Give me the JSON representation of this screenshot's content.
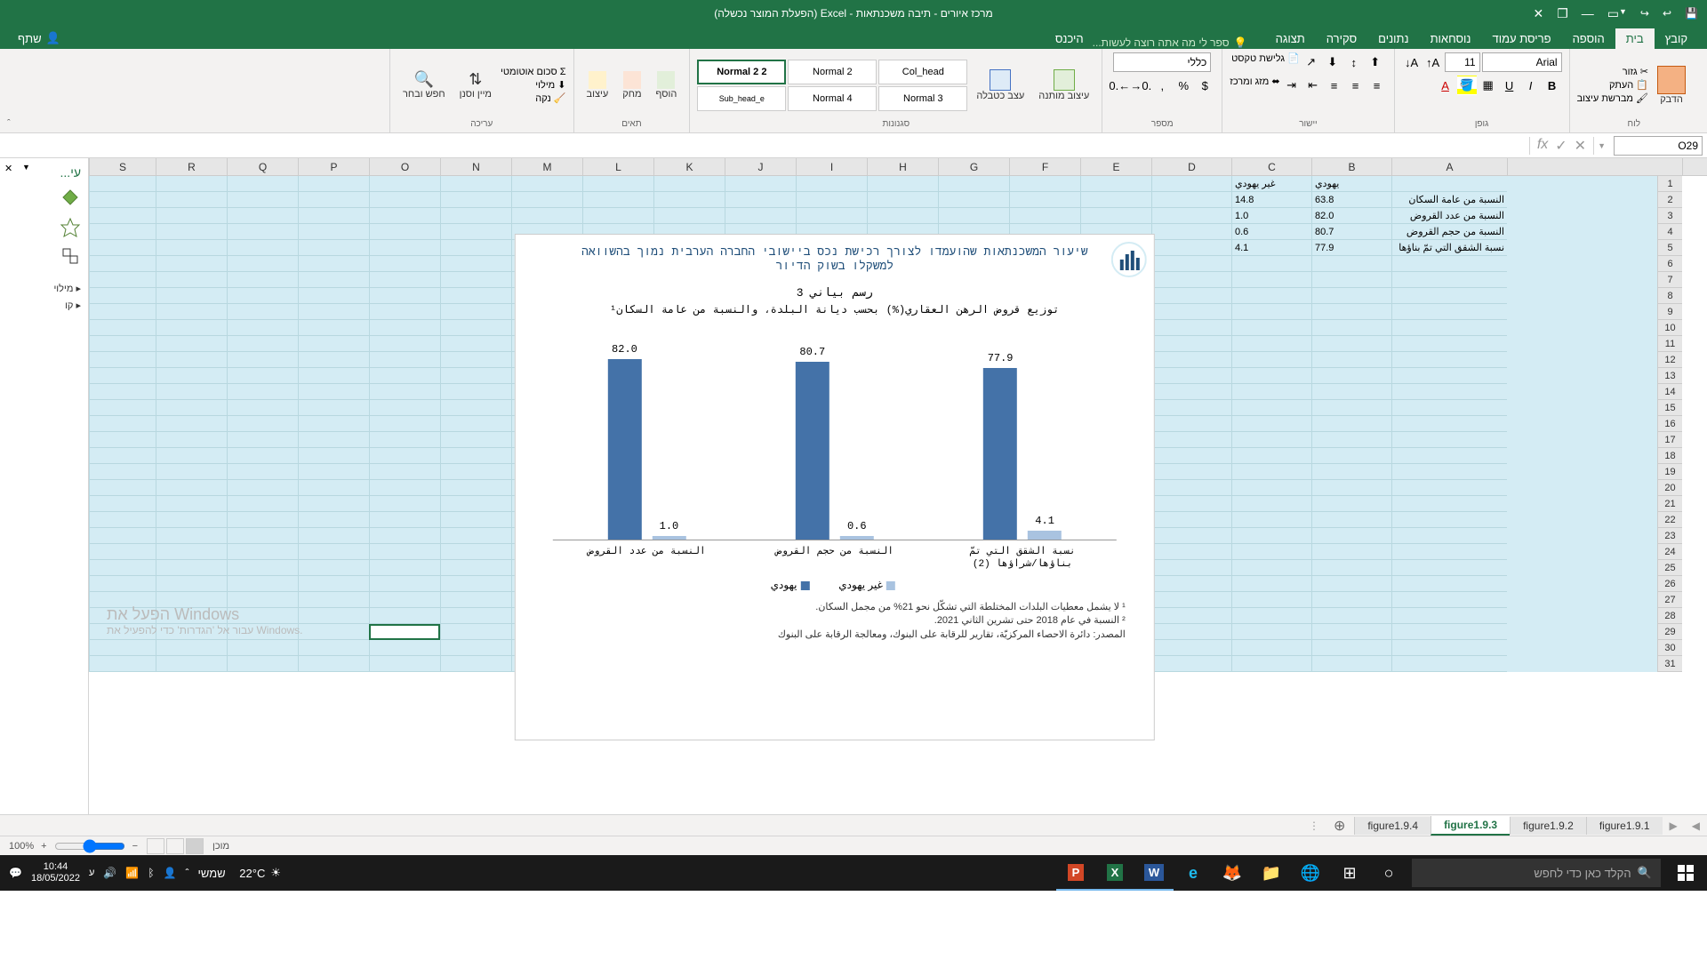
{
  "titlebar": {
    "title": "מרכז איורים - תיבה משכנתאות - Excel (הפעלת המוצר נכשלה)"
  },
  "menu": {
    "file": "קובץ",
    "home": "בית",
    "insert": "הוספה",
    "pagelayout": "פריסת עמוד",
    "formulas": "נוסחאות",
    "data": "נתונים",
    "review": "סקירה",
    "view": "תצוגה",
    "tellme": "ספר לי מה אתה רוצה לעשות...",
    "signin": "היכנס",
    "share": "שתף"
  },
  "ribbon": {
    "clipboard": {
      "label": "לוח",
      "paste": "הדבק",
      "cut": "גזור",
      "copy": "העתק",
      "formatpainter": "מברשת עיצוב"
    },
    "font": {
      "label": "גופן",
      "name": "Arial",
      "size": "11"
    },
    "alignment": {
      "label": "יישור",
      "wrap": "גלישת טקסט",
      "merge": "מזג ומרכז"
    },
    "number": {
      "label": "מספר",
      "format": "כללי"
    },
    "styles": {
      "label": "סגנונות",
      "conditional": "עיצוב מותנה",
      "table": "עצב כטבלה",
      "s1": "Normal 2",
      "s2": "Normal 2 2",
      "s3": "Col_head",
      "s4": "Normal 3",
      "s5": "Normal 4",
      "s6": "Sub_head_e"
    },
    "cells": {
      "label": "תאים",
      "insert": "הוסף",
      "delete": "מחק",
      "format": "עיצוב"
    },
    "editing": {
      "label": "עריכה",
      "sum": "סכום אוטומטי",
      "fill": "מילוי",
      "clear": "נקה",
      "sort": "מיין וסנן",
      "find": "חפש ובחר"
    }
  },
  "namebox": "O29",
  "sidepanel": {
    "title": "עי...",
    "fill": "מילוי",
    "line": "קו"
  },
  "columns": [
    "A",
    "B",
    "C",
    "D",
    "E",
    "F",
    "G",
    "H",
    "I",
    "J",
    "K",
    "L",
    "M",
    "N",
    "O",
    "P",
    "Q",
    "R",
    "S"
  ],
  "data_rows": {
    "h_jewish": "يهودي",
    "h_nonjewish": "غير يهودي",
    "r2_label": "النسبة من عامة السكان",
    "r2_b": "63.8",
    "r2_c": "14.8",
    "r3_label": "النسبة من عدد القروض",
    "r3_b": "82.0",
    "r3_c": "1.0",
    "r4_label": "النسبة من حجم القروض",
    "r4_b": "80.7",
    "r4_c": "0.6",
    "r5_label": "نسبة الشقق التي تمّ بناؤها",
    "r5_b": "77.9",
    "r5_c": "4.1"
  },
  "chart_data": {
    "type": "bar",
    "title_he": "שיעור המשכנתאות שהועמדו לצורך רכישת נכס ביישובי החברה הערבית נמוך בהשוואה למשקלו בשוק הדיור",
    "title_ar_num": "رسم بياني 3",
    "title_ar": "توزيع قروض الرهن العقاري(%) بحسب ديانة البلدة، والنسبة من عامة السكان¹",
    "categories": [
      "النسبة من عدد القروض",
      "النسبة من حجم القروض",
      "نسبة الشقق التي تمّ بناؤها/شراؤها (2)"
    ],
    "series": [
      {
        "name": "يهودي",
        "values": [
          82.0,
          80.7,
          77.9
        ],
        "color": "#4472a8"
      },
      {
        "name": "غير يهودي",
        "values": [
          1.0,
          0.6,
          4.1
        ],
        "color": "#a9c3e0"
      }
    ],
    "ylim": [
      0,
      85
    ],
    "legend": {
      "jewish": "يهودي",
      "nonjewish": "غير يهودي"
    },
    "footnote1": "¹ لا يشمل معطيات البلدات المختلطة التي تشكّل نحو 21% من مجمل السكان.",
    "footnote2": "² النسبة في عام 2018 حتى تشرين الثاني 2021.",
    "source": "المصدر: دائرة الاحصاء المركزيّة، تقارير للرقابة على البنوك، ومعالجة الرقابة على البنوك"
  },
  "activate": {
    "line1": "הפעל את Windows",
    "line2": "עבור אל 'הגדרות' כדי להפעיל את Windows."
  },
  "tabs": {
    "t1": "figure1.9.1",
    "t2": "figure1.9.2",
    "t3": "figure1.9.3",
    "t4": "figure1.9.4"
  },
  "statusbar": {
    "ready": "מוכן",
    "zoom": "100%"
  },
  "taskbar": {
    "search": "הקלד כאן כדי לחפש",
    "weather_temp": "22°C",
    "weather_desc": "שמשי",
    "time": "10:44",
    "date": "18/05/2022"
  }
}
